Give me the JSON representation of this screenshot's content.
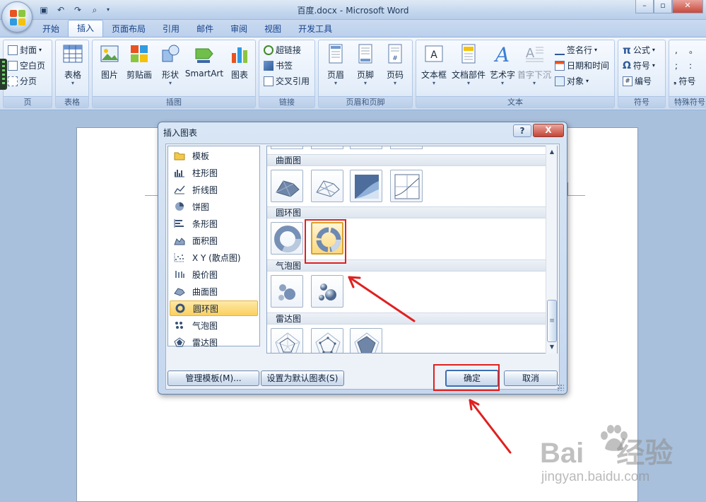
{
  "window": {
    "title": "百度.docx",
    "separator": "-",
    "app": "Microsoft Word"
  },
  "tabs": [
    {
      "label": "开始"
    },
    {
      "label": "插入"
    },
    {
      "label": "页面布局"
    },
    {
      "label": "引用"
    },
    {
      "label": "邮件"
    },
    {
      "label": "审阅"
    },
    {
      "label": "视图"
    },
    {
      "label": "开发工具"
    }
  ],
  "ribbon": {
    "groups": {
      "page": "页",
      "table": "表格",
      "illustrations": "插图",
      "links": "链接",
      "header_footer": "页眉和页脚",
      "text": "文本",
      "symbols": "符号",
      "special": "特殊符号"
    },
    "page_items": [
      "封面",
      "空白页",
      "分页"
    ],
    "table_btn": "表格",
    "illus_btns": [
      "图片",
      "剪贴画",
      "形状",
      "SmartArt",
      "图表"
    ],
    "link_items": [
      "超链接",
      "书签",
      "交叉引用"
    ],
    "hf_btns": [
      "页眉",
      "页脚",
      "页码"
    ],
    "text_btns": [
      "文本框",
      "文档部件",
      "艺术字",
      "首字下沉"
    ],
    "text_small": [
      "签名行",
      "日期和时间",
      "对象"
    ],
    "sym_items": [
      "公式",
      "符号",
      "编号"
    ],
    "special_label": "符号",
    "special_glyphs": [
      ",",
      "。",
      ";",
      ":"
    ]
  },
  "dialog": {
    "title": "插入图表",
    "help": "?",
    "close": "X",
    "categories": [
      {
        "label": "模板",
        "icon": "folder-icon"
      },
      {
        "label": "柱形图",
        "icon": "column-chart-icon"
      },
      {
        "label": "折线图",
        "icon": "line-chart-icon"
      },
      {
        "label": "饼图",
        "icon": "pie-chart-icon"
      },
      {
        "label": "条形图",
        "icon": "bar-chart-icon"
      },
      {
        "label": "面积图",
        "icon": "area-chart-icon"
      },
      {
        "label": "X Y (散点图)",
        "icon": "scatter-chart-icon"
      },
      {
        "label": "股价图",
        "icon": "stock-chart-icon"
      },
      {
        "label": "曲面图",
        "icon": "surface-chart-icon"
      },
      {
        "label": "圆环图",
        "icon": "doughnut-chart-icon",
        "selected": true
      },
      {
        "label": "气泡图",
        "icon": "bubble-chart-icon"
      },
      {
        "label": "雷达图",
        "icon": "radar-chart-icon"
      }
    ],
    "sections": [
      "曲面图",
      "圆环图",
      "气泡图",
      "雷达图"
    ],
    "buttons": {
      "manage": "管理模板(M)...",
      "set_default": "设置为默认图表(S)",
      "ok": "确定",
      "cancel": "取消"
    }
  },
  "watermark": {
    "main_left": "Bai",
    "main_right": "经验",
    "sub": "jingyan.baidu.com"
  },
  "colors": {
    "accent": "#15428b",
    "annotation": "#e02020",
    "selection": "#fbcf5e"
  }
}
